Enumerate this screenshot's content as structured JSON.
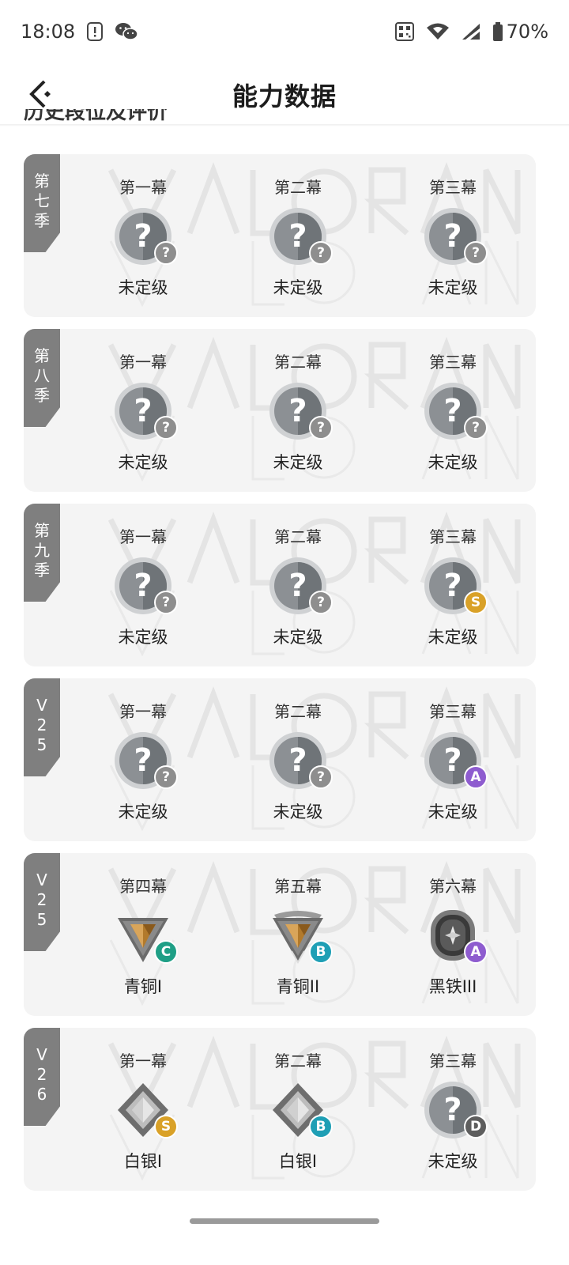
{
  "status_bar": {
    "time": "18:08",
    "battery": "70%"
  },
  "header": {
    "title": "能力数据"
  },
  "section": {
    "title": "历史段位及评价"
  },
  "colors": {
    "card_bg": "#f4f4f4",
    "tag_bg": "#7f7f7f",
    "grade_unknown": "#8e8e8e",
    "grade_s": "#d9a128",
    "grade_a": "#8e5ccf",
    "grade_b": "#1f9fb5",
    "grade_c": "#1f9f86",
    "grade_d": "#5e5e5e"
  },
  "cards": [
    {
      "season": "第七季",
      "acts": [
        {
          "name": "第一幕",
          "rank": "未定级",
          "emblem": "unranked",
          "grade": "?"
        },
        {
          "name": "第二幕",
          "rank": "未定级",
          "emblem": "unranked",
          "grade": "?"
        },
        {
          "name": "第三幕",
          "rank": "未定级",
          "emblem": "unranked",
          "grade": "?"
        }
      ]
    },
    {
      "season": "第八季",
      "acts": [
        {
          "name": "第一幕",
          "rank": "未定级",
          "emblem": "unranked",
          "grade": "?"
        },
        {
          "name": "第二幕",
          "rank": "未定级",
          "emblem": "unranked",
          "grade": "?"
        },
        {
          "name": "第三幕",
          "rank": "未定级",
          "emblem": "unranked",
          "grade": "?"
        }
      ]
    },
    {
      "season": "第九季",
      "acts": [
        {
          "name": "第一幕",
          "rank": "未定级",
          "emblem": "unranked",
          "grade": "?"
        },
        {
          "name": "第二幕",
          "rank": "未定级",
          "emblem": "unranked",
          "grade": "?"
        },
        {
          "name": "第三幕",
          "rank": "未定级",
          "emblem": "unranked",
          "grade": "S"
        }
      ]
    },
    {
      "season": "V25",
      "acts": [
        {
          "name": "第一幕",
          "rank": "未定级",
          "emblem": "unranked",
          "grade": "?"
        },
        {
          "name": "第二幕",
          "rank": "未定级",
          "emblem": "unranked",
          "grade": "?"
        },
        {
          "name": "第三幕",
          "rank": "未定级",
          "emblem": "unranked",
          "grade": "A"
        }
      ]
    },
    {
      "season": "V25",
      "acts": [
        {
          "name": "第四幕",
          "rank": "青铜I",
          "emblem": "bronze1",
          "grade": "C"
        },
        {
          "name": "第五幕",
          "rank": "青铜II",
          "emblem": "bronze2",
          "grade": "B"
        },
        {
          "name": "第六幕",
          "rank": "黑铁III",
          "emblem": "iron3",
          "grade": "A"
        }
      ]
    },
    {
      "season": "V26",
      "acts": [
        {
          "name": "第一幕",
          "rank": "白银I",
          "emblem": "silver1",
          "grade": "S"
        },
        {
          "name": "第二幕",
          "rank": "白银I",
          "emblem": "silver1",
          "grade": "B"
        },
        {
          "name": "第三幕",
          "rank": "未定级",
          "emblem": "unranked",
          "grade": "D"
        }
      ]
    }
  ]
}
